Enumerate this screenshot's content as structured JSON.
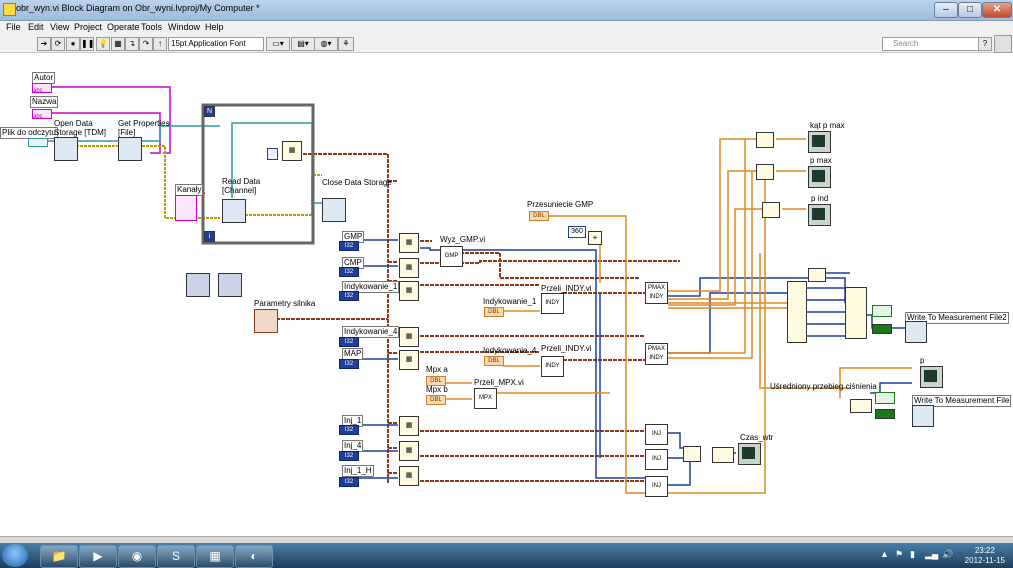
{
  "window": {
    "title": "obr_wyn.vi Block Diagram on Obr_wyni.lvproj/My Computer *",
    "controls": [
      "–",
      "□",
      "✕"
    ]
  },
  "menu": [
    "File",
    "Edit",
    "View",
    "Project",
    "Operate",
    "Tools",
    "Window",
    "Help"
  ],
  "toolbar": {
    "font": "15pt Application Font",
    "search_placeholder": "Search",
    "help_icon": "?"
  },
  "diagram": {
    "inputs": {
      "autor": "Autor",
      "nazwa": "Nazwa",
      "plik": "Plik do odczytu",
      "kanaly": "Kanały",
      "gmp": "GMP",
      "cmp": "CMP",
      "indykowanie1": "Indykowanie_1",
      "indykowanie4": "Indykowanie_4",
      "map": "MAP",
      "inj1": "Inj_1",
      "inj4": "Inj_4",
      "inj1h": "Inj_1_H",
      "parametry": "Parametry silnika",
      "przesuniecie": "Przesuniecie GMP",
      "mpxa": "Mpx a",
      "mpxb": "Mpx b",
      "indyk1_local": "Indykowanie_1",
      "indyk4_local": "Indykowanie_4"
    },
    "nodes": {
      "open_storage": "Open Data Storage [TDM]",
      "get_props": "Get Properties [File]",
      "read_data": "Read Data [Channel]",
      "close_storage": "Close Data Storage",
      "wyz_gmp": "Wyz_GMP.vi",
      "przeli_indy1": "Przeli_INDY.vi",
      "przeli_indy2": "Przeli_INDY.vi",
      "przeli_mpx": "Przeli_MPX.vi",
      "const360": "360",
      "loop_n": "N",
      "loop_i": "i",
      "gmp_tag": "GMP",
      "indy_tag": "INDY",
      "mpx_tag": "MPX",
      "pmax_tag": "PMAX INDY",
      "inj_tag": "INJ",
      "type_i32": "I32",
      "type_dbl": "DBL",
      "type_abc": "abc"
    },
    "outputs": {
      "kat_p_max": "kąt p max",
      "p_max": "p max",
      "p_ind": "p ind",
      "usredniony": "Uśredniony przebieg ciśnienia",
      "p": "p",
      "czas_wtr": "Czas_wtr",
      "write1": "Write To Measurement File2",
      "write2": "Write To Measurement File"
    }
  },
  "taskbar": {
    "time": "23:22",
    "date": "2012-11-15"
  },
  "colors": {
    "wire_int": "#1f3e9a",
    "wire_dbl": "#e08a20",
    "wire_string": "#d000d0",
    "wire_error": "#c8b400",
    "wire_brown": "#8b3a1a",
    "wire_teal": "#2a9a9a"
  }
}
